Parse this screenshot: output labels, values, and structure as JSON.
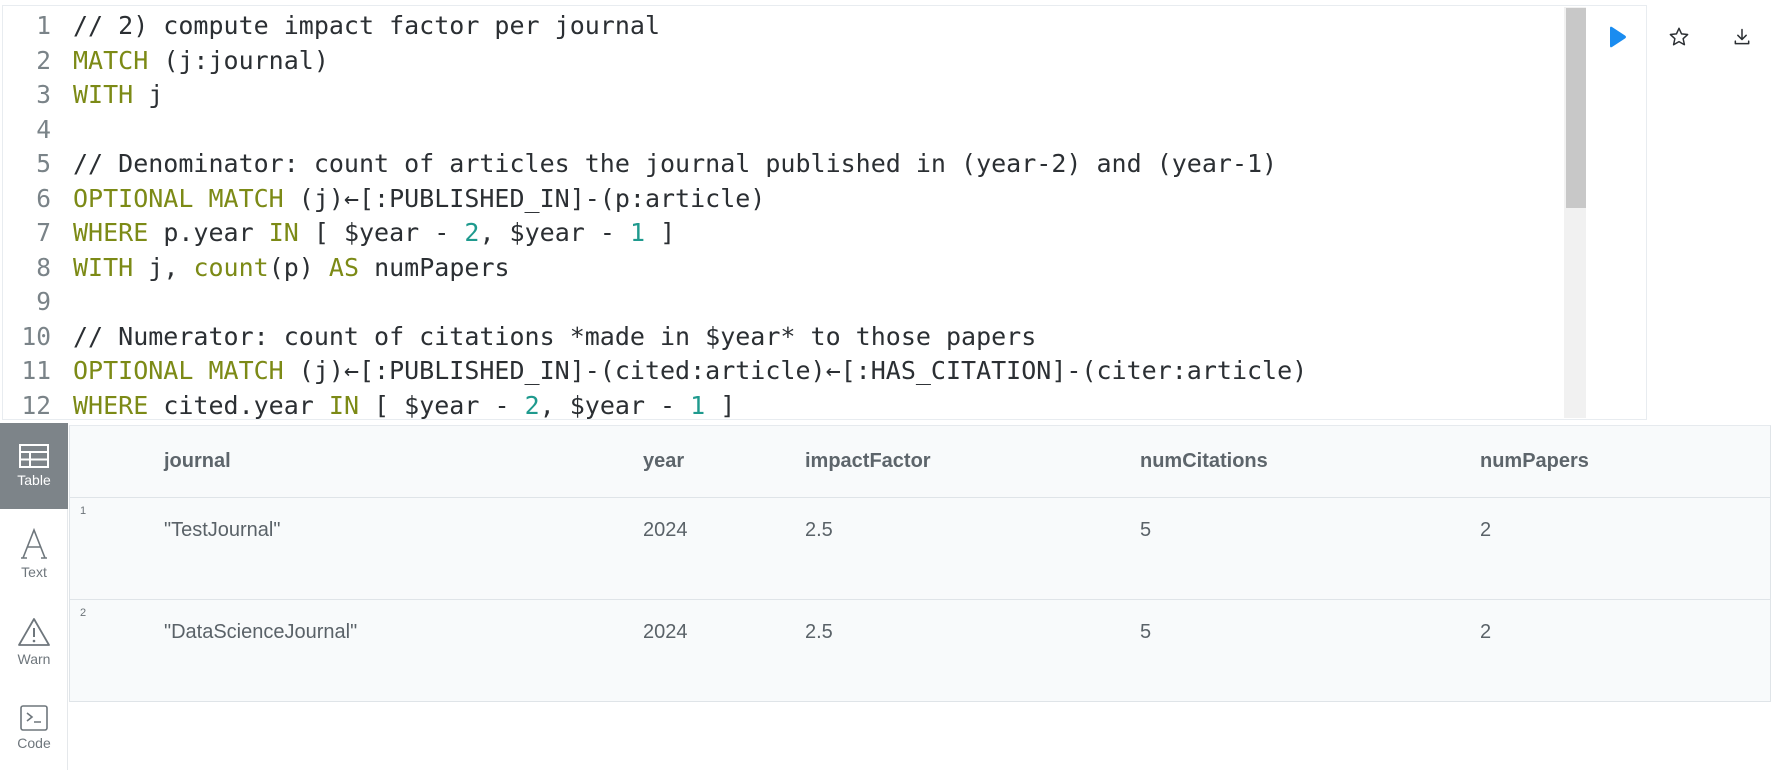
{
  "editor": {
    "lines": [
      [
        {
          "t": "// 2) compute impact factor per journal",
          "c": "cm"
        }
      ],
      [
        {
          "t": "MATCH",
          "c": "kw"
        },
        {
          "t": " (j:journal)",
          "c": ""
        }
      ],
      [
        {
          "t": "WITH",
          "c": "kw"
        },
        {
          "t": " j",
          "c": ""
        }
      ],
      [],
      [
        {
          "t": "// Denominator: count of articles the journal published in (year-2) and (year-1)",
          "c": "cm"
        }
      ],
      [
        {
          "t": "OPTIONAL MATCH",
          "c": "kw"
        },
        {
          "t": " (j)←[:PUBLISHED_IN]-(p:article)",
          "c": ""
        }
      ],
      [
        {
          "t": "WHERE",
          "c": "kw"
        },
        {
          "t": " p.year ",
          "c": ""
        },
        {
          "t": "IN",
          "c": "kw"
        },
        {
          "t": " [ $year - ",
          "c": ""
        },
        {
          "t": "2",
          "c": "num"
        },
        {
          "t": ", $year - ",
          "c": ""
        },
        {
          "t": "1",
          "c": "num"
        },
        {
          "t": " ]",
          "c": ""
        }
      ],
      [
        {
          "t": "WITH",
          "c": "kw"
        },
        {
          "t": " j, ",
          "c": ""
        },
        {
          "t": "count",
          "c": "kw"
        },
        {
          "t": "(p) ",
          "c": ""
        },
        {
          "t": "AS",
          "c": "kw"
        },
        {
          "t": " numPapers",
          "c": ""
        }
      ],
      [],
      [
        {
          "t": "// Numerator: count of citations *made in $year* to those papers",
          "c": "cm"
        }
      ],
      [
        {
          "t": "OPTIONAL MATCH",
          "c": "kw"
        },
        {
          "t": " (j)←[:PUBLISHED_IN]-(cited:article)←[:HAS_CITATION]-(citer:article)",
          "c": ""
        }
      ],
      [
        {
          "t": "WHERE",
          "c": "kw"
        },
        {
          "t": " cited.year ",
          "c": ""
        },
        {
          "t": "IN",
          "c": "kw"
        },
        {
          "t": " [ $year - ",
          "c": ""
        },
        {
          "t": "2",
          "c": "num"
        },
        {
          "t": ", $year - ",
          "c": ""
        },
        {
          "t": "1",
          "c": "num"
        },
        {
          "t": " ]",
          "c": ""
        }
      ]
    ],
    "toolbar": {
      "run_icon": "play-icon",
      "favorite_icon": "star-icon",
      "download_icon": "download-icon"
    }
  },
  "views": [
    {
      "label": "Table",
      "icon": "table-icon",
      "active": true
    },
    {
      "label": "Text",
      "icon": "text-icon",
      "active": false
    },
    {
      "label": "Warn",
      "icon": "warning-icon",
      "active": false
    },
    {
      "label": "Code",
      "icon": "code-icon",
      "active": false
    }
  ],
  "table": {
    "columns": [
      "journal",
      "year",
      "impactFactor",
      "numCitations",
      "numPapers"
    ],
    "rows": [
      {
        "n": "1",
        "cells": [
          "\"TestJournal\"",
          "2024",
          "2.5",
          "5",
          "2"
        ]
      },
      {
        "n": "2",
        "cells": [
          "\"DataScienceJournal\"",
          "2024",
          "2.5",
          "5",
          "2"
        ]
      }
    ]
  },
  "colors": {
    "keyword": "#7c8a16",
    "number": "#1f9a8e",
    "run": "#1a8cf0",
    "active_view": "#7d8489"
  }
}
